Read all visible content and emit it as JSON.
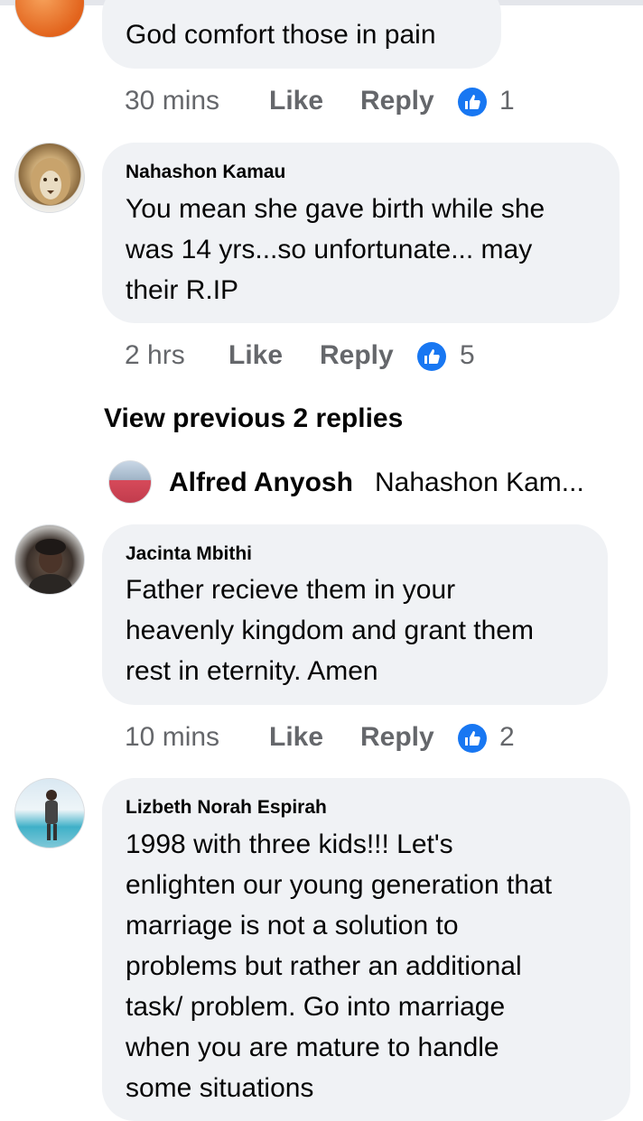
{
  "comments": [
    {
      "text": "God comfort those in pain",
      "time": "30 mins",
      "like_label": "Like",
      "reply_label": "Reply",
      "reaction_count": "1"
    },
    {
      "author": "Nahashon Kamau",
      "text_lines": [
        "You mean she gave birth while she",
        "was 14 yrs...so unfortunate... may",
        "their R.IP"
      ],
      "time": "2 hrs",
      "like_label": "Like",
      "reply_label": "Reply",
      "reaction_count": "5"
    },
    {
      "author": "Jacinta Mbithi",
      "text_lines": [
        "Father recieve them in your",
        "heavenly kingdom and grant them",
        "rest in eternity. Amen"
      ],
      "time": "10 mins",
      "like_label": "Like",
      "reply_label": "Reply",
      "reaction_count": "2"
    },
    {
      "author": "Lizbeth Norah Espirah",
      "text_lines": [
        "1998 with three kids!!! Let's",
        "enlighten our young generation that",
        "marriage is not a solution to",
        "problems but rather an additional",
        "task/ problem. Go into marriage",
        "when you are mature to handle",
        "some situations"
      ]
    }
  ],
  "replies": {
    "view_previous_label": "View previous 2 replies",
    "preview_author": "Alfred Anyosh",
    "preview_text": "Nahashon Kam..."
  },
  "colors": {
    "bubble": "#f0f2f5",
    "meta_text": "#65676b",
    "like_blue": "#1877f2"
  },
  "icons": {
    "reaction": "like-thumb-icon"
  }
}
